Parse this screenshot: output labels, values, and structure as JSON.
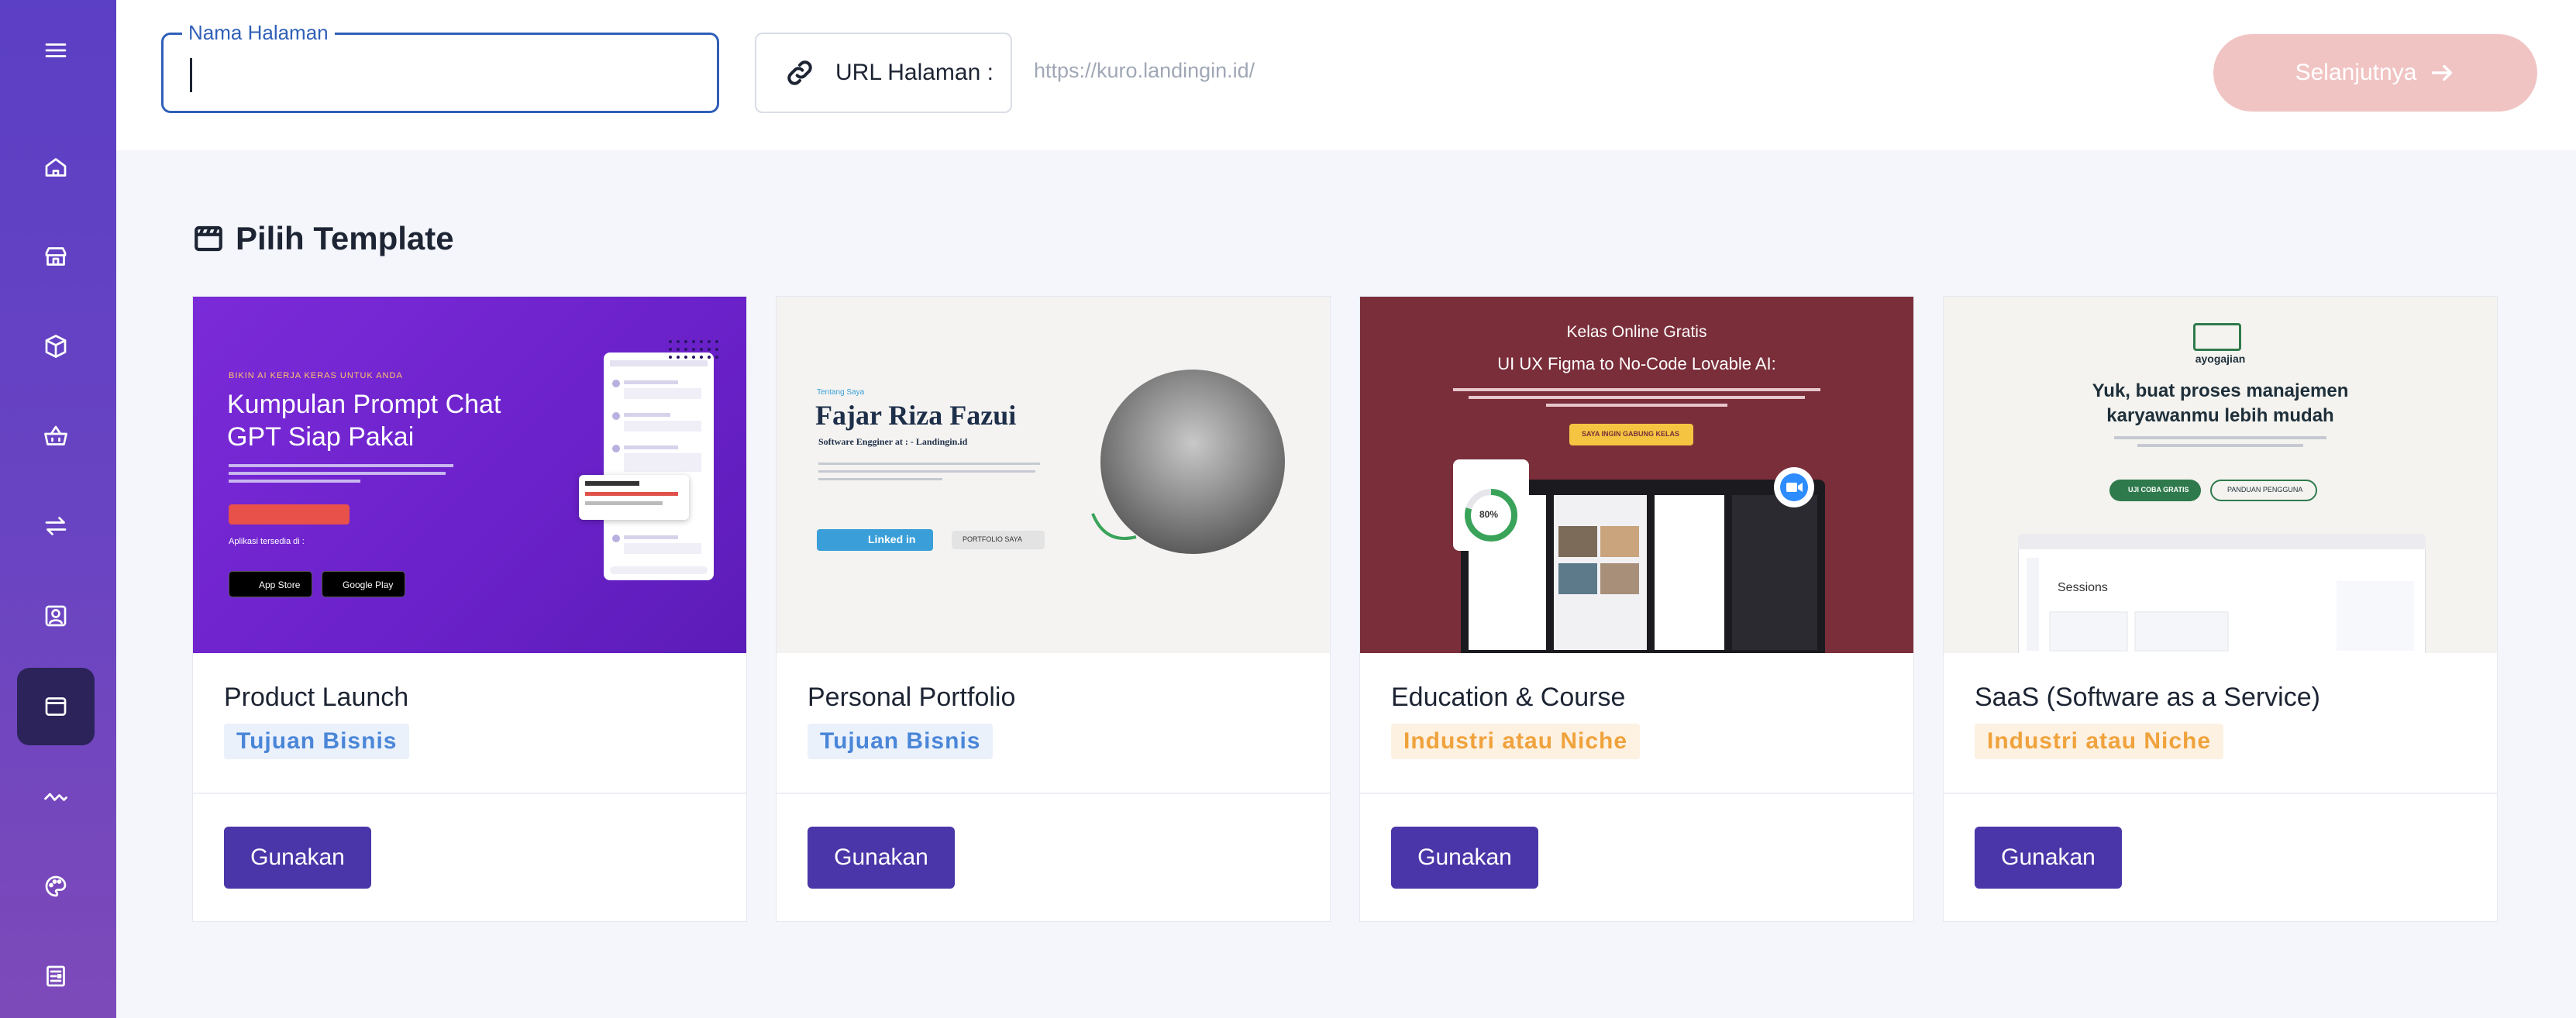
{
  "sidebar": {
    "items": [
      {
        "icon": "menu-icon"
      },
      {
        "icon": "home-icon"
      },
      {
        "icon": "store-icon"
      },
      {
        "icon": "cube-icon"
      },
      {
        "icon": "basket-icon"
      },
      {
        "icon": "transfer-icon"
      },
      {
        "icon": "contact-icon"
      },
      {
        "icon": "browser-icon",
        "active": true
      },
      {
        "icon": "analytics-icon"
      },
      {
        "icon": "palette-icon"
      },
      {
        "icon": "document-icon"
      }
    ]
  },
  "topbar": {
    "name_label": "Nama Halaman",
    "name_value": "",
    "url_label": "URL Halaman :",
    "url_value": "https://kuro.landingin.id/",
    "next_label": "Selanjutnya"
  },
  "section": {
    "title": "Pilih Template"
  },
  "templates": [
    {
      "title": "Product Launch",
      "category": "Tujuan Bisnis",
      "button": "Gunakan",
      "preview": {
        "eyebrow": "BIKIN AI KERJA KERAS UNTUK ANDA",
        "headline": "Kumpulan Prompt Chat GPT Siap Pakai",
        "available_on": "Aplikasi tersedia di :",
        "store1": "App Store",
        "store2": "Google Play"
      }
    },
    {
      "title": "Personal Portfolio",
      "category": "Tujuan Bisnis",
      "button": "Gunakan",
      "preview": {
        "eyebrow": "Tentang Saya",
        "name": "Fajar Riza Fazui",
        "role": "Software Engginer at : - Landingin.id",
        "link1": "Linked in",
        "link2": "PORTFOLIO SAYA"
      }
    },
    {
      "title": "Education & Course",
      "category": "Industri atau Niche",
      "button": "Gunakan",
      "preview": {
        "eyebrow": "Kelas Online Gratis",
        "headline": "UI UX Figma to No-Code Lovable AI:",
        "cta": "SAYA INGIN GABUNG KELAS",
        "stat": "80%"
      }
    },
    {
      "title": "SaaS (Software as a Service)",
      "category": "Industri atau Niche",
      "button": "Gunakan",
      "preview": {
        "brand": "ayogajian",
        "headline": "Yuk, buat proses manajemen karyawanmu lebih mudah",
        "cta1": "UJI COBA GRATIS",
        "cta2": "PANDUAN PENGGUNA",
        "panel": "Sessions"
      }
    }
  ],
  "colors": {
    "sidebar": "#5b3fc4",
    "primary_button": "#4a36a8",
    "next_button_disabled": "#f1c4c4",
    "focus_border": "#2f5fb8",
    "badge_business": "#4a86d8",
    "badge_niche": "#f0a23c"
  }
}
